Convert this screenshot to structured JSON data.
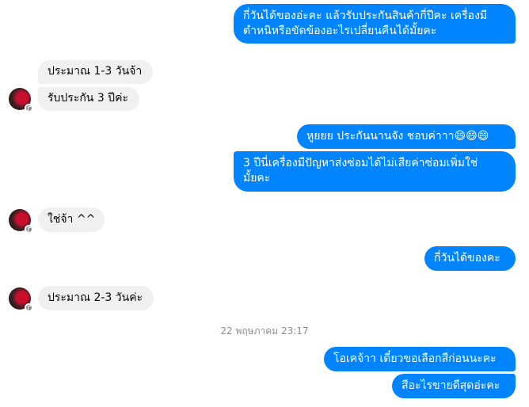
{
  "conversation": {
    "timestamp": "22 พฤษภาคม 23:17",
    "messages": [
      {
        "text": "กี่วันได้ของอ่ะคะ แล้วรับประกันสินค้ากี่ปีคะ เครื่องมี\nตำหนิหรือขัดข้องอะไรเปลี่ยนคืนได้มั้ยคะ",
        "direction": "outgoing"
      },
      {
        "text": "ประมาณ 1-3 วันจ้า",
        "direction": "incoming"
      },
      {
        "text": "รับประกัน 3 ปีค่ะ",
        "direction": "incoming"
      },
      {
        "text": "หูยยย ประกันนานจัง ชอบค่าาา😄😄😄",
        "direction": "outgoing"
      },
      {
        "text": "3 ปีนี่เครื่องมีปัญหาส่งซ่อมได้ไม่เสียค่าซ่อมเพิ่มใช่\nมั้ยคะ",
        "direction": "outgoing"
      },
      {
        "text": "ใช่จ้า ^^",
        "direction": "incoming"
      },
      {
        "text": "กี่วันได้ของคะ",
        "direction": "outgoing"
      },
      {
        "text": "ประมาณ 2-3 วันค่ะ",
        "direction": "incoming"
      },
      {
        "text": "โอเคจ้าา เดี๋ยวขอเลือกสีก่อนนะคะ",
        "direction": "outgoing"
      },
      {
        "text": "สีอะไรขายดีสุดอ่ะคะ",
        "direction": "outgoing"
      }
    ]
  },
  "colors": {
    "outgoing_bubble": "#0084ff",
    "incoming_bubble": "#f0f0f0",
    "timestamp_text": "#8a8d91"
  }
}
